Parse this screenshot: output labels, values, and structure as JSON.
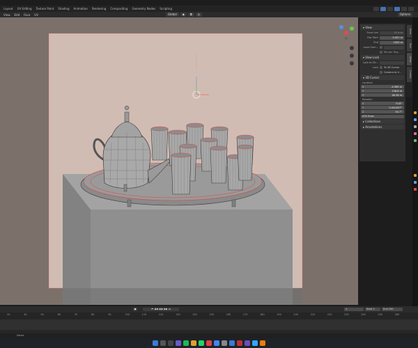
{
  "workspaces": [
    "Layout",
    "UV Editing",
    "Texture Paint",
    "Shading",
    "Animation",
    "Rendering",
    "Compositing",
    "Geometry Nodes",
    "Scripting"
  ],
  "header_menu": [
    "View",
    "Edit",
    "Face",
    "UV"
  ],
  "transform_orientation": "Global",
  "options_label": "Options",
  "view_panel": {
    "title": "View",
    "focal_length": {
      "label": "Focal Len",
      "value": "50 mm"
    },
    "clip_start": {
      "label": "Clip Start",
      "value": "0.001 m"
    },
    "clip_end": {
      "label": "End",
      "value": "1000 m"
    },
    "local_camera": {
      "label": "Local Cam...",
      "value": ""
    },
    "render_region": {
      "label": "Render Reg..."
    }
  },
  "view_lock": {
    "title": "View Lock",
    "lock_to_object": {
      "label": "Lock to Ob..."
    },
    "lock": {
      "label": "Lock",
      "option": "To 3D Cursor"
    },
    "camera_to_view": {
      "option": "Camera to V..."
    }
  },
  "cursor_panel": {
    "title": "3D Cursor",
    "location_label": "Location",
    "location": [
      {
        "axis": "X",
        "value": "-4.369 m"
      },
      {
        "axis": "Y",
        "value": "136.6 m"
      },
      {
        "axis": "Z",
        "value": "48.36 m"
      }
    ],
    "rotation_label": "Rotation",
    "rotation": [
      {
        "axis": "X",
        "value": "73.8°"
      },
      {
        "axis": "Y",
        "value": "0.000057°"
      },
      {
        "axis": "Z",
        "value": "55.7°"
      }
    ],
    "rotation_mode": "XYZ Euler"
  },
  "collections_title": "Collections",
  "annotations_title": "Annotations",
  "sidebar_tabs": [
    "Item",
    "Tool",
    "View",
    "Create"
  ],
  "timeline": {
    "current_frame": "1",
    "start_label": "Start",
    "start": "1",
    "end_label": "End",
    "end": "250",
    "ruler": [
      "30",
      "40",
      "50",
      "60",
      "70",
      "80",
      "90",
      "100",
      "110",
      "120",
      "130",
      "140",
      "150",
      "160",
      "170",
      "180",
      "190",
      "200",
      "210",
      "220",
      "230",
      "240",
      "250",
      "260"
    ]
  },
  "status": "Select",
  "colors": {
    "viewport": "#7c706b",
    "accent": "#4772b3",
    "edge_select": "#e5484d"
  }
}
